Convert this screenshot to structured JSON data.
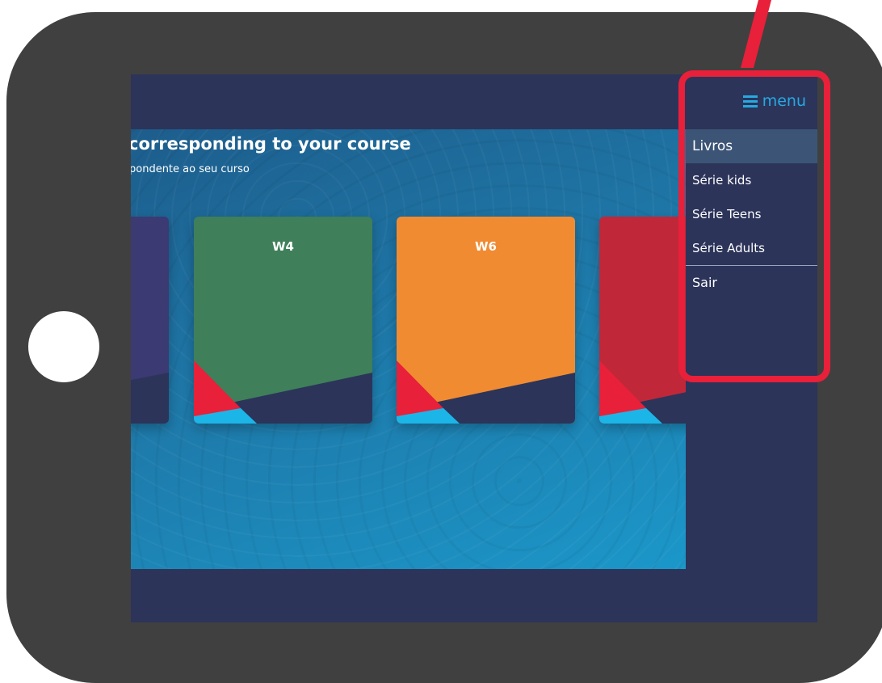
{
  "screen": {
    "title": "corresponding to your course",
    "subtitle": "pondente ao seu curso"
  },
  "cards": [
    {
      "label": "",
      "color": "#3b3a73"
    },
    {
      "label": "W4",
      "color": "#3f7f5a"
    },
    {
      "label": "W6",
      "color": "#f18b31"
    },
    {
      "label": "",
      "color": "#c0283a"
    }
  ],
  "menu": {
    "toggle_icon": "hamburger-icon",
    "toggle_label": "menu",
    "items": [
      {
        "label": "Livros"
      },
      {
        "label": "Série kids"
      },
      {
        "label": "Série Teens"
      },
      {
        "label": "Série Adults"
      },
      {
        "label": "Sair"
      }
    ]
  },
  "colors": {
    "frame": "#404040",
    "screen_bg": "#2c345a",
    "menu_accent": "#27a9e1",
    "highlight": "#e8203a",
    "card_dark": "#2c345a",
    "card_red": "#e8203a",
    "card_cyan": "#1cb5e8"
  }
}
